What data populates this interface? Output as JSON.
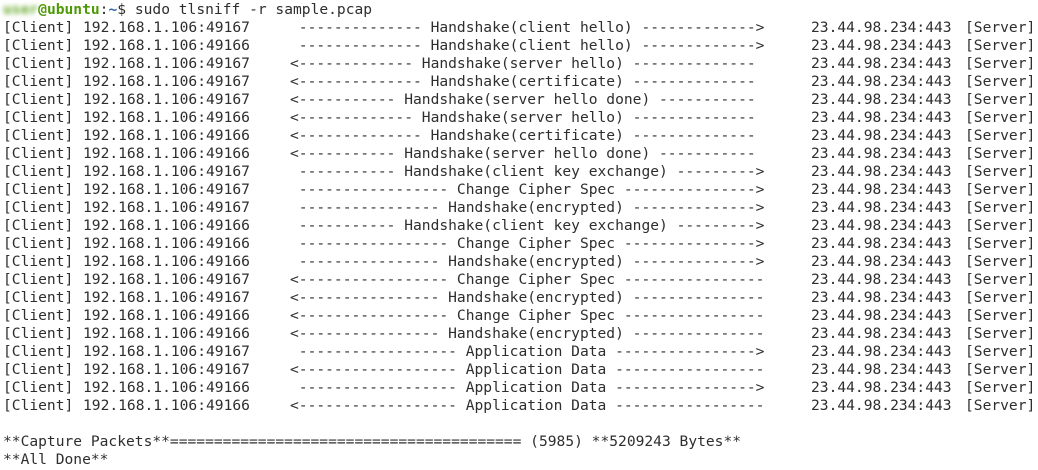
{
  "prompt": {
    "user": "user",
    "at": "@",
    "host": "ubuntu",
    "sep": ":",
    "path": "~",
    "symbol": "$ ",
    "command": "sudo tlsniff -r sample.pcap"
  },
  "colors": {
    "prompt_green": "#4e9a06",
    "prompt_blue": "#3465a4",
    "text": "#2e2e2e",
    "background": "#ffffff"
  },
  "rows": [
    {
      "role": "[Client]",
      "addr": "192.168.1.106:49167",
      "flow": " -------------- Handshake(client hello) ------------->",
      "dst": "23.44.98.234:443",
      "srv": "[Server]"
    },
    {
      "role": "[Client]",
      "addr": "192.168.1.106:49166",
      "flow": " -------------- Handshake(client hello) ------------->",
      "dst": "23.44.98.234:443",
      "srv": "[Server]"
    },
    {
      "role": "[Client]",
      "addr": "192.168.1.106:49167",
      "flow": "<------------- Handshake(server hello) --------------",
      "dst": "23.44.98.234:443",
      "srv": "[Server]"
    },
    {
      "role": "[Client]",
      "addr": "192.168.1.106:49167",
      "flow": "<-------------- Handshake(certificate) --------------",
      "dst": "23.44.98.234:443",
      "srv": "[Server]"
    },
    {
      "role": "[Client]",
      "addr": "192.168.1.106:49167",
      "flow": "<----------- Handshake(server hello done) -----------",
      "dst": "23.44.98.234:443",
      "srv": "[Server]"
    },
    {
      "role": "[Client]",
      "addr": "192.168.1.106:49166",
      "flow": "<------------- Handshake(server hello) --------------",
      "dst": "23.44.98.234:443",
      "srv": "[Server]"
    },
    {
      "role": "[Client]",
      "addr": "192.168.1.106:49166",
      "flow": "<-------------- Handshake(certificate) --------------",
      "dst": "23.44.98.234:443",
      "srv": "[Server]"
    },
    {
      "role": "[Client]",
      "addr": "192.168.1.106:49166",
      "flow": "<----------- Handshake(server hello done) -----------",
      "dst": "23.44.98.234:443",
      "srv": "[Server]"
    },
    {
      "role": "[Client]",
      "addr": "192.168.1.106:49167",
      "flow": " ----------- Handshake(client key exchange) --------->",
      "dst": "23.44.98.234:443",
      "srv": "[Server]"
    },
    {
      "role": "[Client]",
      "addr": "192.168.1.106:49167",
      "flow": " ----------------- Change Cipher Spec --------------->",
      "dst": "23.44.98.234:443",
      "srv": "[Server]"
    },
    {
      "role": "[Client]",
      "addr": "192.168.1.106:49167",
      "flow": " ---------------- Handshake(encrypted) -------------->",
      "dst": "23.44.98.234:443",
      "srv": "[Server]"
    },
    {
      "role": "[Client]",
      "addr": "192.168.1.106:49166",
      "flow": " ----------- Handshake(client key exchange) --------->",
      "dst": "23.44.98.234:443",
      "srv": "[Server]"
    },
    {
      "role": "[Client]",
      "addr": "192.168.1.106:49166",
      "flow": " ----------------- Change Cipher Spec --------------->",
      "dst": "23.44.98.234:443",
      "srv": "[Server]"
    },
    {
      "role": "[Client]",
      "addr": "192.168.1.106:49166",
      "flow": " ---------------- Handshake(encrypted) -------------->",
      "dst": "23.44.98.234:443",
      "srv": "[Server]"
    },
    {
      "role": "[Client]",
      "addr": "192.168.1.106:49167",
      "flow": "<----------------- Change Cipher Spec ----------------",
      "dst": "23.44.98.234:443",
      "srv": "[Server]"
    },
    {
      "role": "[Client]",
      "addr": "192.168.1.106:49167",
      "flow": "<---------------- Handshake(encrypted) ---------------",
      "dst": "23.44.98.234:443",
      "srv": "[Server]"
    },
    {
      "role": "[Client]",
      "addr": "192.168.1.106:49166",
      "flow": "<----------------- Change Cipher Spec ----------------",
      "dst": "23.44.98.234:443",
      "srv": "[Server]"
    },
    {
      "role": "[Client]",
      "addr": "192.168.1.106:49166",
      "flow": "<---------------- Handshake(encrypted) ---------------",
      "dst": "23.44.98.234:443",
      "srv": "[Server]"
    },
    {
      "role": "[Client]",
      "addr": "192.168.1.106:49167",
      "flow": " ------------------ Application Data ---------------->",
      "dst": "23.44.98.234:443",
      "srv": "[Server]"
    },
    {
      "role": "[Client]",
      "addr": "192.168.1.106:49167",
      "flow": "<------------------ Application Data -----------------",
      "dst": "23.44.98.234:443",
      "srv": "[Server]"
    },
    {
      "role": "[Client]",
      "addr": "192.168.1.106:49166",
      "flow": " ------------------ Application Data ---------------->",
      "dst": "23.44.98.234:443",
      "srv": "[Server]"
    },
    {
      "role": "[Client]",
      "addr": "192.168.1.106:49166",
      "flow": "<------------------ Application Data -----------------",
      "dst": "23.44.98.234:443",
      "srv": "[Server]"
    }
  ],
  "summary": {
    "capture_line": "**Capture Packets**======================================== (5985) **5209243 Bytes**",
    "done_line": "**All Done**"
  }
}
